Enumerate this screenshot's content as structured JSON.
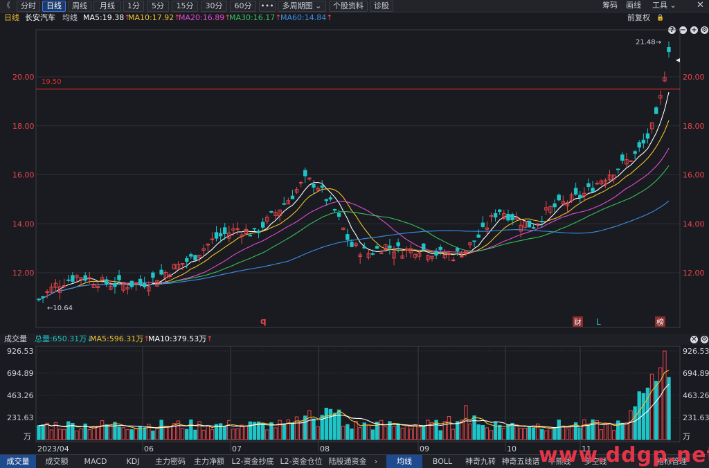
{
  "toolbar": {
    "back": "《",
    "tabs": [
      "分时",
      "日线",
      "周线",
      "月线",
      "1分",
      "5分",
      "15分",
      "30分",
      "60分",
      "•••",
      "多周期图 ⌄",
      "个股资料",
      "诊股"
    ],
    "active_tab": "日线",
    "right_items": [
      "筹码",
      "画线",
      "工具 ⌄"
    ]
  },
  "ma_header": {
    "period": "日线",
    "stock_name": "长安汽车",
    "type_label": "均线",
    "ma5": "MA5:19.38",
    "ma10": "MA10:17.92",
    "ma20": "MA20:16.89",
    "ma30": "MA30:16.17",
    "ma60": "MA60:14.84",
    "up_arrow": "↑",
    "adjust": "前复权",
    "lock_icon": "🔒"
  },
  "colors": {
    "up": "#e8474d",
    "down": "#1fc4c7",
    "ma5": "#ffffff",
    "ma10": "#f2c12e",
    "ma20": "#e24bd5",
    "ma30": "#36c05a",
    "ma60": "#3a8fe8",
    "ref": "#e02c2c"
  },
  "price_chart": {
    "y_ticks": [
      "20.00",
      "18.00",
      "16.00",
      "14.00",
      "12.00"
    ],
    "ref_line_label": "19.50",
    "high_label": "21.48→",
    "low_label": "←10.64",
    "markers": {
      "q": "q",
      "cai": "财",
      "L": "L",
      "bang": "榜"
    }
  },
  "chart_data": {
    "type": "candlestick",
    "ma_values": {
      "MA5": 19.38,
      "MA10": 17.92,
      "MA20": 16.89,
      "MA30": 16.17,
      "MA60": 14.84
    },
    "price_axis": [
      12.0,
      14.0,
      16.0,
      18.0,
      20.0
    ],
    "reference_level": 19.5,
    "period_high": 21.48,
    "period_low": 10.64,
    "x_labels": [
      "2023/04",
      "06",
      "07",
      "08",
      "09",
      "10",
      "11"
    ],
    "volume_axis": [
      231.63,
      463.26,
      694.89,
      926.53
    ],
    "volume_unit": "万"
  },
  "volume_header": {
    "label": "成交量",
    "total": "总量:650.31万",
    "total_arrow": "↓",
    "ma5": "MA5:596.31万",
    "ma5_arrow": "↑",
    "ma10": "MA10:379.53万",
    "ma10_arrow": "↑"
  },
  "volume_chart": {
    "y_ticks": [
      "926.53",
      "694.89",
      "463.26",
      "231.63"
    ],
    "unit": "万",
    "x_labels": [
      "2023/04",
      "06",
      "07",
      "08",
      "09",
      "10",
      "11"
    ]
  },
  "bottom_tabs": [
    "成交量",
    "成交额",
    "MACD",
    "KDJ",
    "主力密码",
    "主力净额",
    "L2-资金抄底",
    "L2-资金仓位",
    "陆股通资金",
    "›",
    "均线",
    "BOLL",
    "神奇九转",
    "神奇五线谱",
    "牛熊线",
    "多空线",
    "指标管理"
  ],
  "watermark": "www.ddgp.net"
}
